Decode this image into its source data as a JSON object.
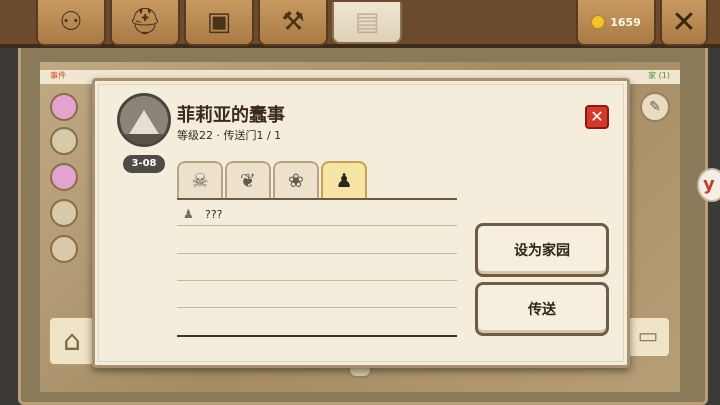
{
  "topbar": {
    "tabs": [
      {
        "icon": "skill-tree-icon",
        "glyph": "⚇",
        "active": false
      },
      {
        "icon": "helmet-icon",
        "glyph": "⛑",
        "active": false
      },
      {
        "icon": "treasure-chest-icon",
        "glyph": "▣",
        "active": false
      },
      {
        "icon": "hammer-scroll-icon",
        "glyph": "⚒",
        "active": false
      },
      {
        "icon": "map-icon",
        "glyph": "▤",
        "active": true
      }
    ],
    "coins": "1659",
    "close_glyph": "✕"
  },
  "background": {
    "left_label": "事件",
    "right_label": "家 (1)"
  },
  "dialog": {
    "title": "菲莉亚的蠢事",
    "subtitle": "等级22 · 传送门1 / 1",
    "level_badge": "3-08",
    "close_glyph": "✕",
    "filter_tabs": [
      {
        "icon": "skull-icon",
        "glyph": "☠",
        "active": false
      },
      {
        "icon": "leaf-icon",
        "glyph": "❦",
        "active": false
      },
      {
        "icon": "creature-icon",
        "glyph": "❀",
        "active": false
      },
      {
        "icon": "person-icon",
        "glyph": "♟",
        "active": true
      }
    ],
    "entries": [
      {
        "icon": "person-icon",
        "text": "???"
      }
    ],
    "set_home_label": "设为家园",
    "teleport_label": "传送"
  }
}
